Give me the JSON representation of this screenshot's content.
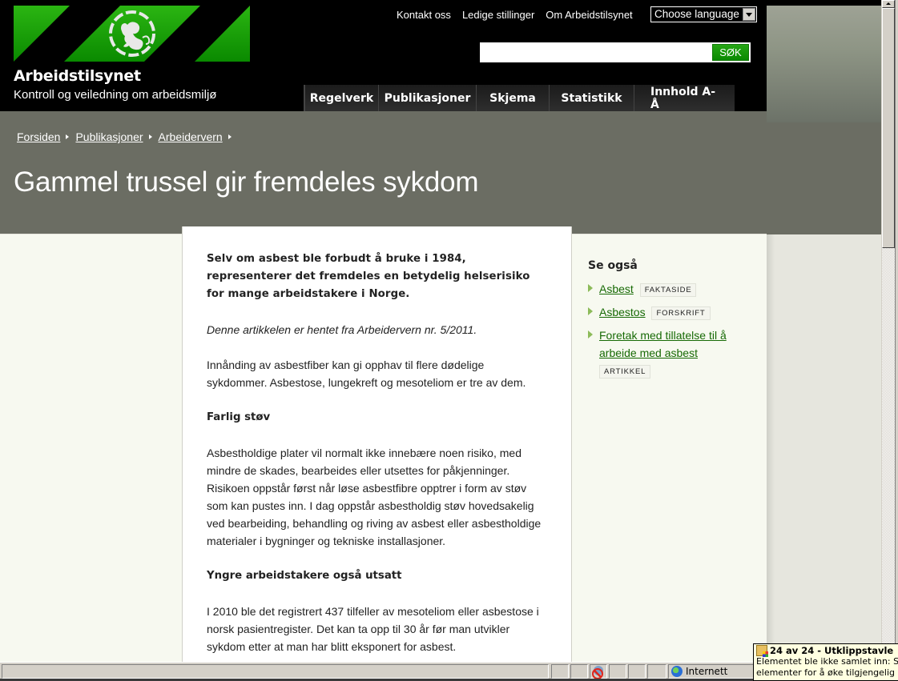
{
  "site": {
    "name": "Arbeidstilsynet",
    "tagline": "Kontroll og veiledning om arbeidsmiljø",
    "brand_green": "#1ea60e",
    "logo_icon": "lion-emblem-icon"
  },
  "top_links": [
    "Kontakt oss",
    "Ledige stillinger",
    "Om Arbeidstilsynet"
  ],
  "language_select": {
    "value": "Choose language"
  },
  "search": {
    "value": "",
    "placeholder": "",
    "button_label": "SØK"
  },
  "main_nav": [
    "Regelverk",
    "Publikasjoner",
    "Skjema",
    "Statistikk",
    "Innhold A-Å"
  ],
  "breadcrumb": [
    "Forsiden",
    "Publikasjoner",
    "Arbeidervern"
  ],
  "page_title": "Gammel trussel gir fremdeles sykdom",
  "article": {
    "lead": "Selv om asbest ble forbudt å bruke i 1984, representerer det fremdeles en betydelig helserisiko for mange arbeidstakere i Norge.",
    "source": "Denne artikkelen er hentet fra Arbeidervern nr. 5/2011.",
    "paragraph_1": "Innånding av asbestfiber kan gi opphav til flere dødelige sykdommer. Asbestose, lungekreft og mesoteliom er tre av dem.",
    "subhead_1": "Farlig støv",
    "paragraph_2": "Asbestholdige plater vil normalt ikke innebære noen risiko, med mindre de skades, bearbeides eller utsettes for påkjenninger. Risikoen oppstår først når løse asbestfibre opptrer i form av støv som kan pustes inn. I dag oppstår asbestholdig støv hovedsakelig ved bearbeiding, behandling og riving av asbest eller asbestholdige materialer i bygninger og tekniske installasjoner.",
    "subhead_2": "Yngre arbeidstakere også utsatt",
    "paragraph_3": "I 2010 ble det registrert 437 tilfeller av mesoteliom eller asbestose i norsk pasientregister. Det kan ta opp til 30 år før man utvikler sykdom etter at man har blitt eksponert for asbest."
  },
  "see_also": {
    "title": "Se også",
    "items": [
      {
        "label": "Asbest",
        "tag": "FAKTASIDE"
      },
      {
        "label": "Asbestos",
        "tag": "FORSKRIFT"
      },
      {
        "label": "Foretak med tillatelse til å arbeide med asbest",
        "tag": "ARTIKKEL"
      }
    ]
  },
  "status_bar": {
    "zone": "Internett"
  },
  "balloon": {
    "title": "24 av 24 - Utklippstavle",
    "text_line_1": "Elementet ble ikke samlet inn: Slett",
    "text_line_2": "elementer for å øke tilgjengelig plass."
  }
}
